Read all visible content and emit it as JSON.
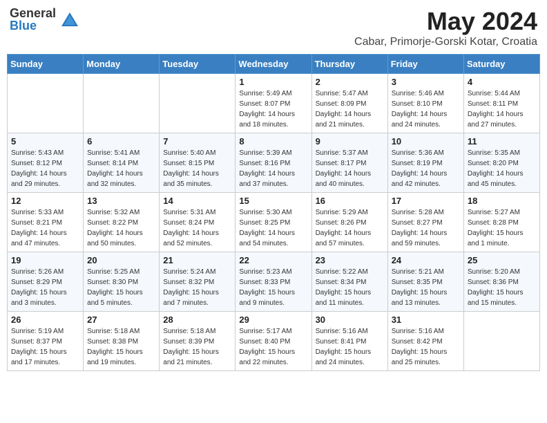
{
  "header": {
    "logo": {
      "general": "General",
      "blue": "Blue"
    },
    "title": "May 2024",
    "location": "Cabar, Primorje-Gorski Kotar, Croatia"
  },
  "days_of_week": [
    "Sunday",
    "Monday",
    "Tuesday",
    "Wednesday",
    "Thursday",
    "Friday",
    "Saturday"
  ],
  "weeks": [
    [
      {
        "day": "",
        "info": []
      },
      {
        "day": "",
        "info": []
      },
      {
        "day": "",
        "info": []
      },
      {
        "day": "1",
        "info": [
          "Sunrise: 5:49 AM",
          "Sunset: 8:07 PM",
          "Daylight: 14 hours and 18 minutes."
        ]
      },
      {
        "day": "2",
        "info": [
          "Sunrise: 5:47 AM",
          "Sunset: 8:09 PM",
          "Daylight: 14 hours and 21 minutes."
        ]
      },
      {
        "day": "3",
        "info": [
          "Sunrise: 5:46 AM",
          "Sunset: 8:10 PM",
          "Daylight: 14 hours and 24 minutes."
        ]
      },
      {
        "day": "4",
        "info": [
          "Sunrise: 5:44 AM",
          "Sunset: 8:11 PM",
          "Daylight: 14 hours and 27 minutes."
        ]
      }
    ],
    [
      {
        "day": "5",
        "info": [
          "Sunrise: 5:43 AM",
          "Sunset: 8:12 PM",
          "Daylight: 14 hours and 29 minutes."
        ]
      },
      {
        "day": "6",
        "info": [
          "Sunrise: 5:41 AM",
          "Sunset: 8:14 PM",
          "Daylight: 14 hours and 32 minutes."
        ]
      },
      {
        "day": "7",
        "info": [
          "Sunrise: 5:40 AM",
          "Sunset: 8:15 PM",
          "Daylight: 14 hours and 35 minutes."
        ]
      },
      {
        "day": "8",
        "info": [
          "Sunrise: 5:39 AM",
          "Sunset: 8:16 PM",
          "Daylight: 14 hours and 37 minutes."
        ]
      },
      {
        "day": "9",
        "info": [
          "Sunrise: 5:37 AM",
          "Sunset: 8:17 PM",
          "Daylight: 14 hours and 40 minutes."
        ]
      },
      {
        "day": "10",
        "info": [
          "Sunrise: 5:36 AM",
          "Sunset: 8:19 PM",
          "Daylight: 14 hours and 42 minutes."
        ]
      },
      {
        "day": "11",
        "info": [
          "Sunrise: 5:35 AM",
          "Sunset: 8:20 PM",
          "Daylight: 14 hours and 45 minutes."
        ]
      }
    ],
    [
      {
        "day": "12",
        "info": [
          "Sunrise: 5:33 AM",
          "Sunset: 8:21 PM",
          "Daylight: 14 hours and 47 minutes."
        ]
      },
      {
        "day": "13",
        "info": [
          "Sunrise: 5:32 AM",
          "Sunset: 8:22 PM",
          "Daylight: 14 hours and 50 minutes."
        ]
      },
      {
        "day": "14",
        "info": [
          "Sunrise: 5:31 AM",
          "Sunset: 8:24 PM",
          "Daylight: 14 hours and 52 minutes."
        ]
      },
      {
        "day": "15",
        "info": [
          "Sunrise: 5:30 AM",
          "Sunset: 8:25 PM",
          "Daylight: 14 hours and 54 minutes."
        ]
      },
      {
        "day": "16",
        "info": [
          "Sunrise: 5:29 AM",
          "Sunset: 8:26 PM",
          "Daylight: 14 hours and 57 minutes."
        ]
      },
      {
        "day": "17",
        "info": [
          "Sunrise: 5:28 AM",
          "Sunset: 8:27 PM",
          "Daylight: 14 hours and 59 minutes."
        ]
      },
      {
        "day": "18",
        "info": [
          "Sunrise: 5:27 AM",
          "Sunset: 8:28 PM",
          "Daylight: 15 hours and 1 minute."
        ]
      }
    ],
    [
      {
        "day": "19",
        "info": [
          "Sunrise: 5:26 AM",
          "Sunset: 8:29 PM",
          "Daylight: 15 hours and 3 minutes."
        ]
      },
      {
        "day": "20",
        "info": [
          "Sunrise: 5:25 AM",
          "Sunset: 8:30 PM",
          "Daylight: 15 hours and 5 minutes."
        ]
      },
      {
        "day": "21",
        "info": [
          "Sunrise: 5:24 AM",
          "Sunset: 8:32 PM",
          "Daylight: 15 hours and 7 minutes."
        ]
      },
      {
        "day": "22",
        "info": [
          "Sunrise: 5:23 AM",
          "Sunset: 8:33 PM",
          "Daylight: 15 hours and 9 minutes."
        ]
      },
      {
        "day": "23",
        "info": [
          "Sunrise: 5:22 AM",
          "Sunset: 8:34 PM",
          "Daylight: 15 hours and 11 minutes."
        ]
      },
      {
        "day": "24",
        "info": [
          "Sunrise: 5:21 AM",
          "Sunset: 8:35 PM",
          "Daylight: 15 hours and 13 minutes."
        ]
      },
      {
        "day": "25",
        "info": [
          "Sunrise: 5:20 AM",
          "Sunset: 8:36 PM",
          "Daylight: 15 hours and 15 minutes."
        ]
      }
    ],
    [
      {
        "day": "26",
        "info": [
          "Sunrise: 5:19 AM",
          "Sunset: 8:37 PM",
          "Daylight: 15 hours and 17 minutes."
        ]
      },
      {
        "day": "27",
        "info": [
          "Sunrise: 5:18 AM",
          "Sunset: 8:38 PM",
          "Daylight: 15 hours and 19 minutes."
        ]
      },
      {
        "day": "28",
        "info": [
          "Sunrise: 5:18 AM",
          "Sunset: 8:39 PM",
          "Daylight: 15 hours and 21 minutes."
        ]
      },
      {
        "day": "29",
        "info": [
          "Sunrise: 5:17 AM",
          "Sunset: 8:40 PM",
          "Daylight: 15 hours and 22 minutes."
        ]
      },
      {
        "day": "30",
        "info": [
          "Sunrise: 5:16 AM",
          "Sunset: 8:41 PM",
          "Daylight: 15 hours and 24 minutes."
        ]
      },
      {
        "day": "31",
        "info": [
          "Sunrise: 5:16 AM",
          "Sunset: 8:42 PM",
          "Daylight: 15 hours and 25 minutes."
        ]
      },
      {
        "day": "",
        "info": []
      }
    ]
  ]
}
